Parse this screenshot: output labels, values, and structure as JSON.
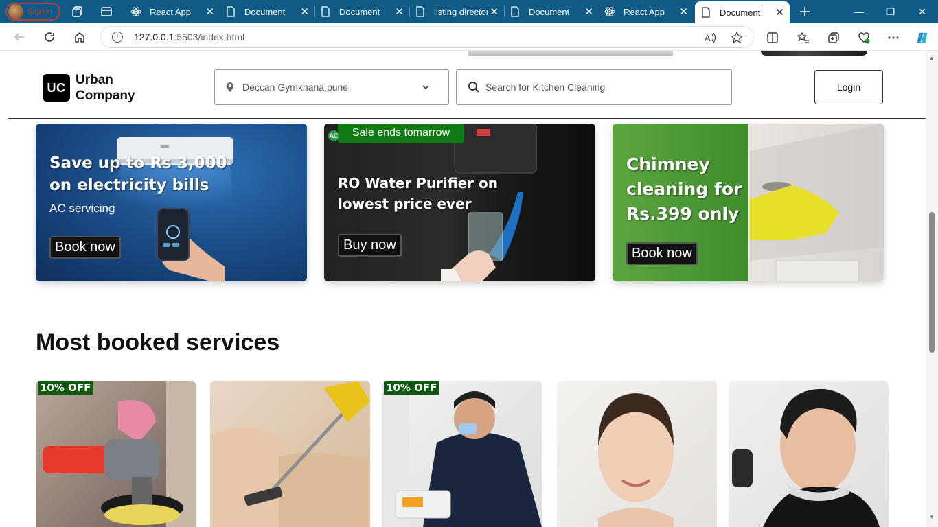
{
  "browser": {
    "profile_label": "Sign in",
    "tabs": [
      {
        "label": "React App",
        "icon": "react-icon"
      },
      {
        "label": "Document",
        "icon": "document-icon"
      },
      {
        "label": "Document",
        "icon": "document-icon"
      },
      {
        "label": "listing director",
        "icon": "document-icon"
      },
      {
        "label": "Document",
        "icon": "document-icon"
      },
      {
        "label": "React App",
        "icon": "react-icon"
      },
      {
        "label": "Document",
        "icon": "document-icon",
        "active": true
      }
    ],
    "url_host": "127.0.0.1",
    "url_rest": ":5503/index.html"
  },
  "header": {
    "logo_mark": "UC",
    "logo_line1": "Urban",
    "logo_line2": "Company",
    "location": "Deccan Gymkhana,pune",
    "search_placeholder": "Search for Kitchen Cleaning",
    "login_label": "Login"
  },
  "banners": [
    {
      "title_line1": "Save up to Rs 3,000",
      "title_line2": "on electricity bills",
      "subtitle": "AC servicing",
      "button": "Book now"
    },
    {
      "tag": "Sale ends tomarrow",
      "badge": "AC",
      "title_line1": "RO Water Purifier on",
      "title_line2": "lowest price ever",
      "button": "Buy now"
    },
    {
      "title_line1": "Chimney",
      "title_line2": "cleaning for",
      "title_line3": "Rs.399 only",
      "button": "Book now"
    }
  ],
  "section": {
    "title": "Most booked services"
  },
  "services": [
    {
      "badge": "10% OFF"
    },
    {
      "badge": ""
    },
    {
      "badge": "10% OFF"
    },
    {
      "badge": ""
    },
    {
      "badge": ""
    }
  ],
  "colors": {
    "tabbar": "#0f5b86",
    "sale_tag": "#0f7b12",
    "offer_badge": "#0b5a0d"
  }
}
